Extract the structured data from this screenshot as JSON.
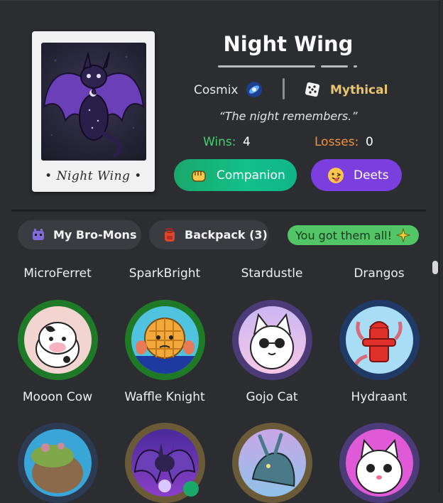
{
  "card": {
    "caption": "• Night Wing •"
  },
  "profile": {
    "title": "Night Wing",
    "owner": "Cosmix",
    "rarity": "Mythical",
    "quote": "“The night remembers.”",
    "wins_label": "Wins:",
    "wins": "4",
    "losses_label": "Losses:",
    "losses": "0"
  },
  "actions": {
    "companion_label": "Companion",
    "deets_label": "Deets"
  },
  "tabs": {
    "mons_label": "My Bro-Mons",
    "backpack_label": "Backpack (3)",
    "badge_text": "You got them all!"
  },
  "grid": {
    "top_names": [
      "MicroFerret",
      "SparkBright",
      "Stardustle",
      "Drangos"
    ],
    "row1": [
      "Mooon Cow",
      "Waffle Knight",
      "Gojo Cat",
      "Hydraant"
    ]
  },
  "colors": {
    "wins": "#3fd46b",
    "losses": "#f0953f",
    "rarity": "#e8c66f",
    "deets": "#7b3fe0",
    "companion": "#12c08a"
  }
}
